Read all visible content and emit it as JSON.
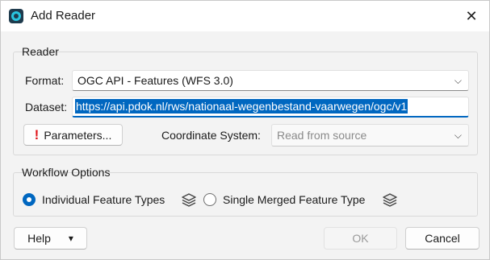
{
  "window": {
    "title": "Add Reader",
    "close_glyph": "✕"
  },
  "reader": {
    "group_title": "Reader",
    "format_label": "Format:",
    "format_value": "OGC API - Features (WFS 3.0)",
    "dataset_label": "Dataset:",
    "dataset_value": "https://api.pdok.nl/rws/nationaal-wegenbestand-vaarwegen/ogc/v1",
    "parameters_warn_glyph": "!",
    "parameters_label": "Parameters...",
    "coord_label": "Coordinate System:",
    "coord_value": "Read from source",
    "chevron_glyph": "⌵"
  },
  "workflow": {
    "group_title": "Workflow Options",
    "options": [
      {
        "label": "Individual Feature Types",
        "checked": true,
        "icon": "layers-icon"
      },
      {
        "label": "Single Merged Feature Type",
        "checked": false,
        "icon": "layers-icon"
      }
    ]
  },
  "footer": {
    "help_label": "Help",
    "help_arrow": "▾",
    "ok_label": "OK",
    "cancel_label": "Cancel"
  },
  "colors": {
    "accent": "#0067c0",
    "warning": "#e0161b"
  }
}
